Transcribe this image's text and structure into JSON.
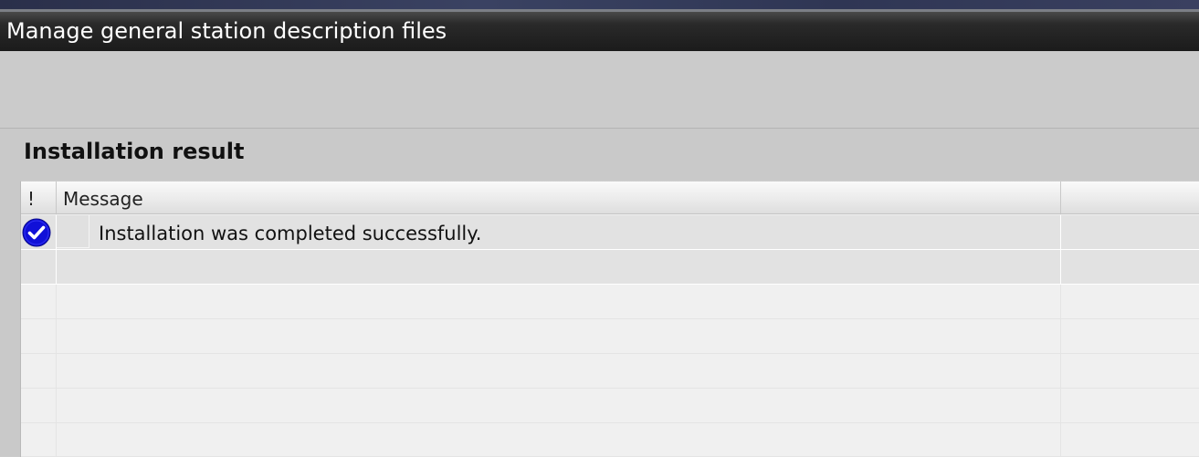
{
  "window": {
    "title": "Manage general station description files"
  },
  "section": {
    "heading": "Installation result"
  },
  "table": {
    "columns": [
      {
        "label": "!"
      },
      {
        "label": "Message"
      },
      {
        "label": ""
      }
    ],
    "rows": [
      {
        "status_icon": "success-check-icon",
        "message": "Installation was completed successfully."
      }
    ]
  },
  "colors": {
    "success_icon_fill": "#1010d8",
    "title_bar": "#1b1b1b"
  }
}
